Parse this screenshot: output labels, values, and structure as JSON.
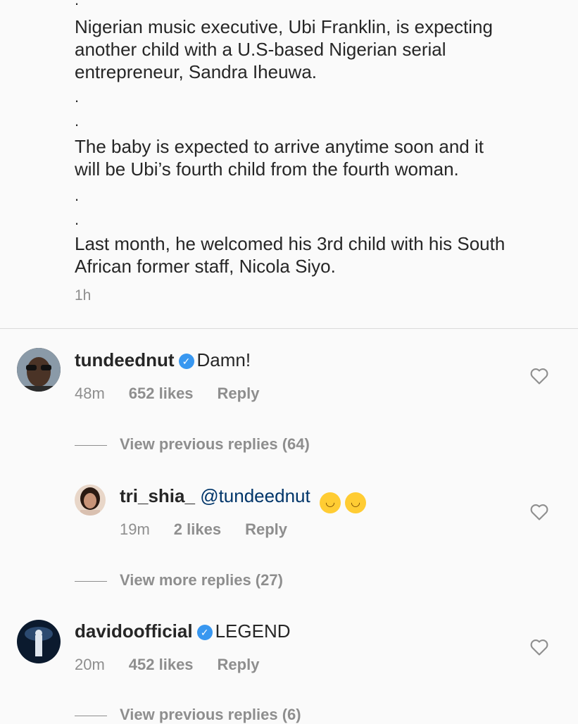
{
  "post": {
    "dots": [
      "."
    ],
    "paragraph1": [
      "Nigerian music executive, Ubi Franklin, is expecting",
      "another child with a U.S-based Nigerian serial",
      "entrepreneur, Sandra Iheuwa."
    ],
    "paragraph2": [
      "The baby is expected to arrive anytime soon and it",
      "will be Ubi’s fourth child from the fourth woman."
    ],
    "paragraph3": [
      "Last month, he welcomed his 3rd child with his South",
      "African former staff, Nicola Siyo."
    ],
    "time": "1h"
  },
  "comments": [
    {
      "username": "tundeednut",
      "verified": true,
      "text": "Damn!",
      "time": "48m",
      "likes": "652 likes",
      "reply": "Reply"
    },
    {
      "username": "tri_shia_",
      "verified": false,
      "mention": "@tundeednut",
      "emojis": [
        "rolling-on-floor-laughing-emoji",
        "tears-of-joy-emoji"
      ],
      "time": "19m",
      "likes": "2 likes",
      "reply": "Reply"
    },
    {
      "username": "davidoofficial",
      "verified": true,
      "text": "LEGEND",
      "time": "20m",
      "likes": "452 likes",
      "reply": "Reply"
    }
  ],
  "view_replies": [
    "View previous replies (64)",
    "View more replies (27)",
    "View previous replies (6)"
  ],
  "colors": {
    "text": "#262626",
    "muted": "#8e8e8e",
    "verified": "#3897f0",
    "mention": "#003569"
  }
}
